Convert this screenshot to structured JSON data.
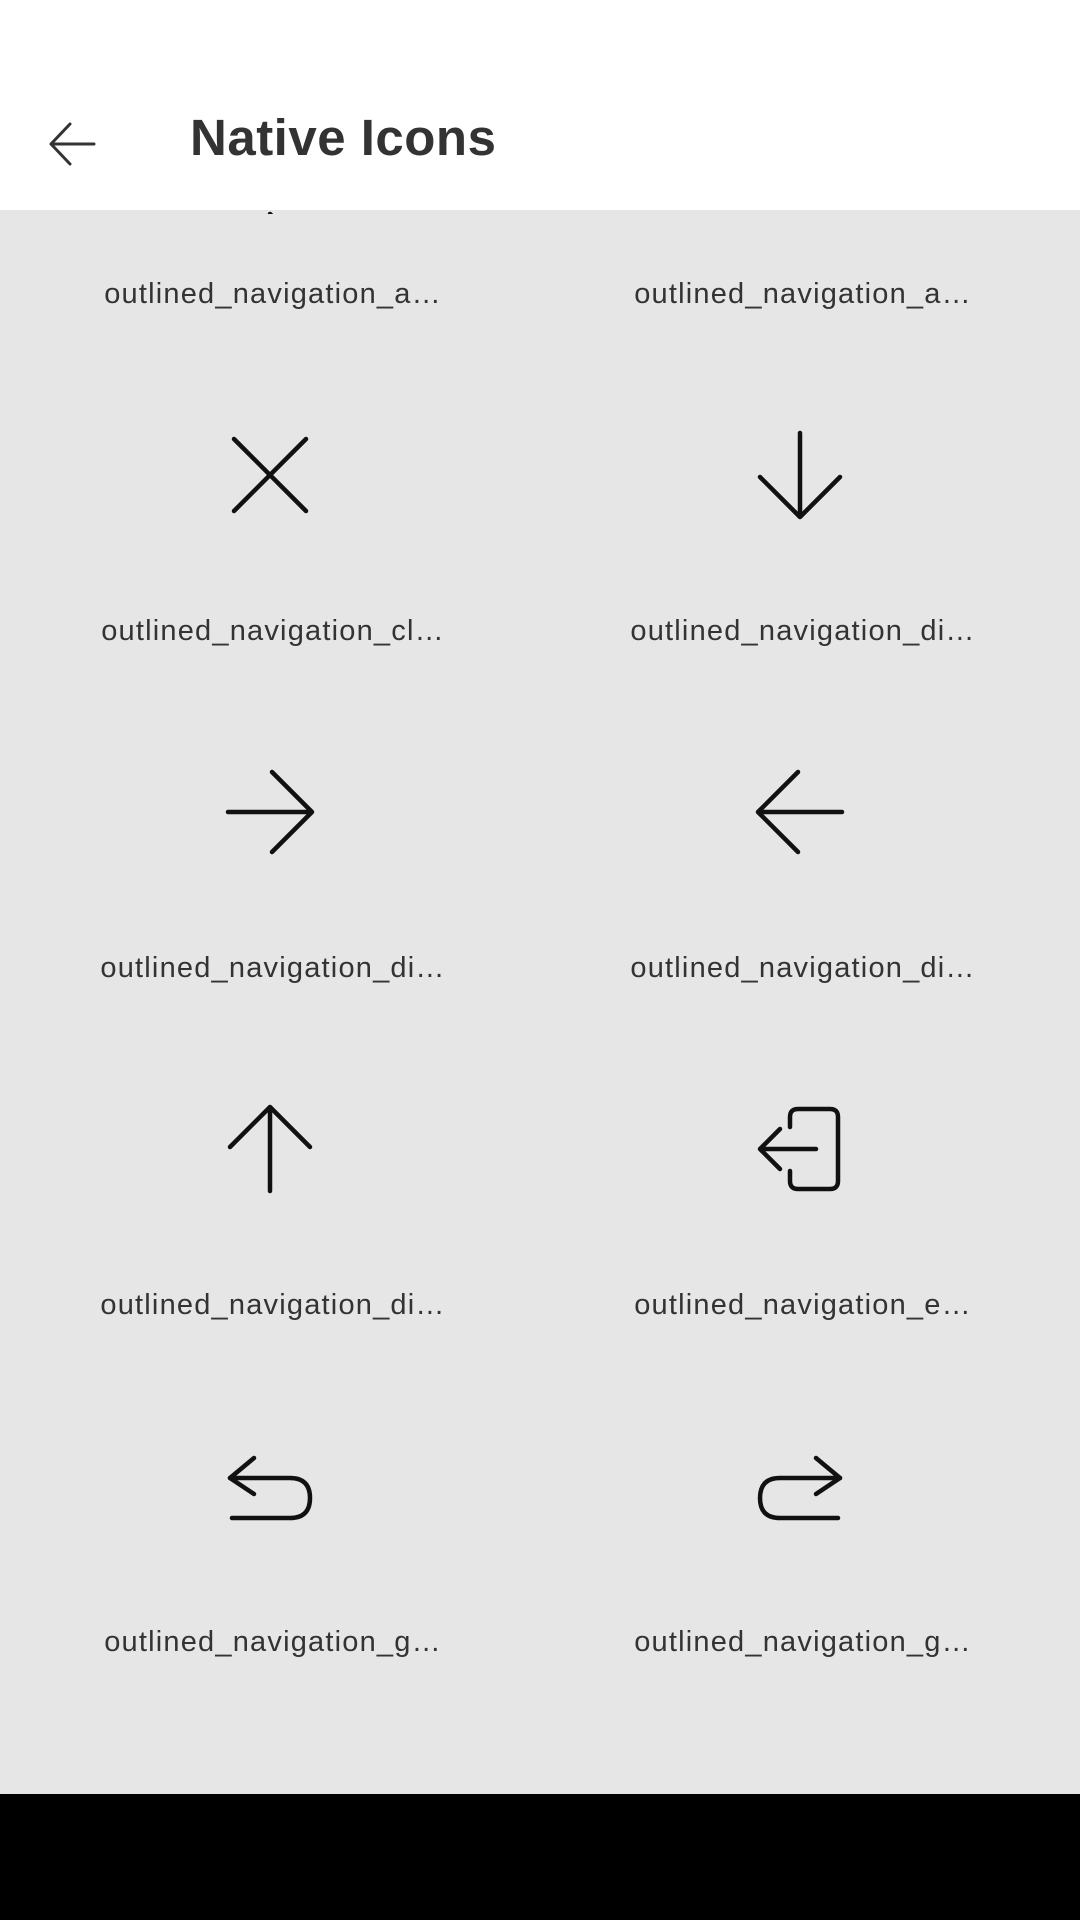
{
  "app_bar": {
    "title": "Native Icons",
    "back_icon": "arrow-left-icon"
  },
  "icons": [
    {
      "label": "outlined_navigation_a…",
      "icon": "partial-arrow-icon"
    },
    {
      "label": "outlined_navigation_a…",
      "icon": "none"
    },
    {
      "label": "outlined_navigation_cl…",
      "icon": "close-icon"
    },
    {
      "label": "outlined_navigation_di…",
      "icon": "arrow-down-icon"
    },
    {
      "label": "outlined_navigation_di…",
      "icon": "arrow-right-icon"
    },
    {
      "label": "outlined_navigation_di…",
      "icon": "arrow-left-icon"
    },
    {
      "label": "outlined_navigation_di…",
      "icon": "arrow-up-icon"
    },
    {
      "label": "outlined_navigation_e…",
      "icon": "exit-icon"
    },
    {
      "label": "outlined_navigation_g…",
      "icon": "go-back-icon"
    },
    {
      "label": "outlined_navigation_g…",
      "icon": "go-forward-icon"
    }
  ]
}
